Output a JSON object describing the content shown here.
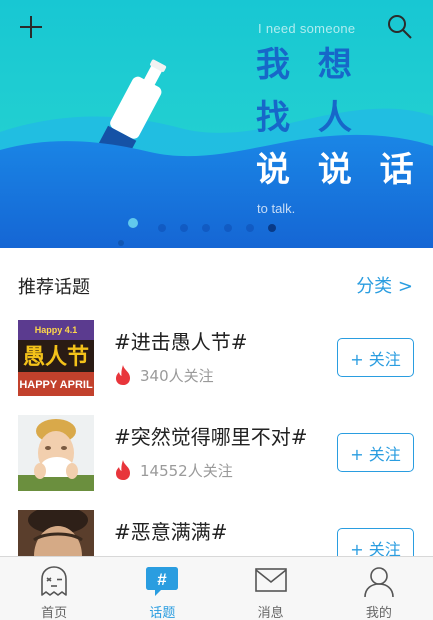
{
  "banner": {
    "tagline_top": "I need someone",
    "headline_line1": "我 想",
    "headline_line2": "找 人",
    "headline_line3": "说 说 话",
    "tagline_bottom": "to talk.",
    "slide_count": 6,
    "active_slide": 5
  },
  "section": {
    "title": "推荐话题",
    "more_label": "分类 >"
  },
  "topics": [
    {
      "title": "#进击愚人节#",
      "count": "340人关注",
      "follow_label": "+ 关注",
      "thumb_text": "Happy 4.1"
    },
    {
      "title": "#突然觉得哪里不对#",
      "count": "14552人关注",
      "follow_label": "+ 关注"
    },
    {
      "title": "#恶意满满#",
      "count": "",
      "follow_label": "+ 关注"
    }
  ],
  "tabs": [
    {
      "label": "首页",
      "icon": "ghost-icon"
    },
    {
      "label": "话题",
      "icon": "hashtag-icon",
      "active": true
    },
    {
      "label": "消息",
      "icon": "envelope-icon"
    },
    {
      "label": "我的",
      "icon": "person-icon"
    }
  ],
  "colors": {
    "accent": "#2a9de0",
    "banner_top": "#1cc9d6",
    "banner_wave": "#1677e0",
    "headline_blue": "#1767c9",
    "fire": "#e8353b"
  }
}
